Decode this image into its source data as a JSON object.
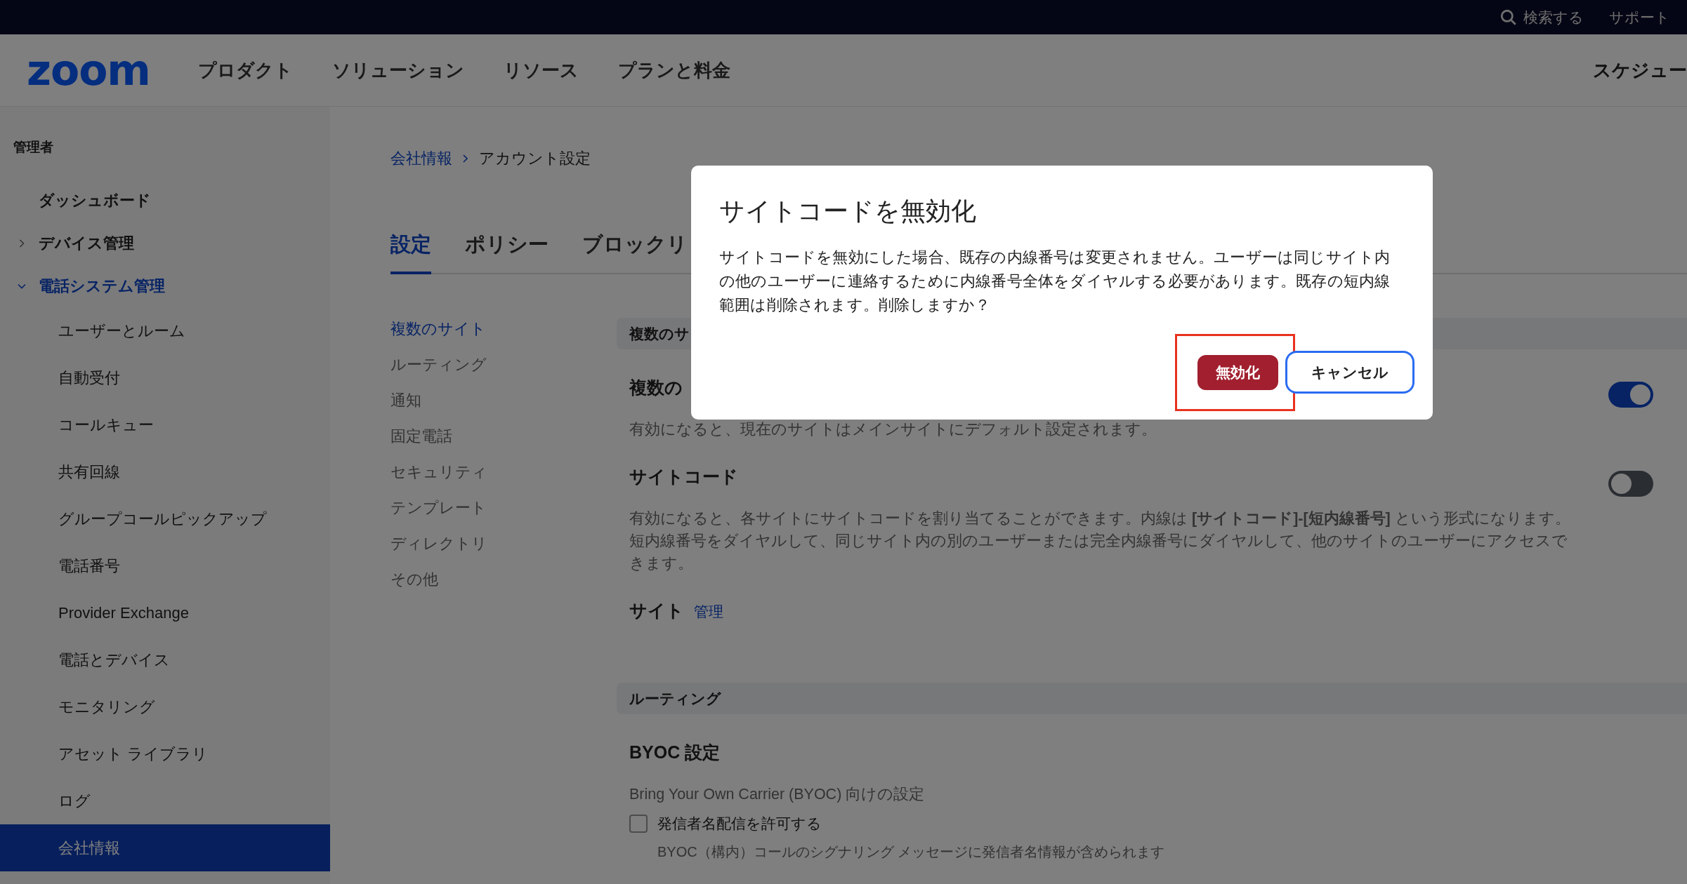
{
  "top_bar": {
    "search_label": "検索する",
    "support": "サポート"
  },
  "nav": {
    "logo": "zoom",
    "items": [
      "プロダクト",
      "ソリューション",
      "リソース",
      "プランと料金"
    ],
    "right": "スケジュー"
  },
  "sidebar": {
    "heading": "管理者",
    "items": [
      {
        "label": "ダッシュボード"
      },
      {
        "label": "デバイス管理",
        "expanded": false
      },
      {
        "label": "電話システム管理",
        "expanded": true,
        "children": [
          {
            "label": "ユーザーとルーム",
            "selected": false
          },
          {
            "label": "自動受付",
            "selected": false
          },
          {
            "label": "コールキュー",
            "selected": false
          },
          {
            "label": "共有回線",
            "selected": false
          },
          {
            "label": "グループコールピックアップ",
            "selected": false
          },
          {
            "label": "電話番号",
            "selected": false
          },
          {
            "label": "Provider Exchange",
            "selected": false
          },
          {
            "label": "電話とデバイス",
            "selected": false
          },
          {
            "label": "モニタリング",
            "selected": false
          },
          {
            "label": "アセット ライブラリ",
            "selected": false
          },
          {
            "label": "ログ",
            "selected": false
          },
          {
            "label": "会社情報",
            "selected": true
          }
        ]
      }
    ]
  },
  "breadcrumb": [
    {
      "label": "会社情報",
      "kind": "link"
    },
    {
      "label": "アカウント設定",
      "kind": "current"
    }
  ],
  "tabs": [
    {
      "label": "設定",
      "selected": true
    },
    {
      "label": "ポリシー",
      "selected": false
    },
    {
      "label": "ブロックリ",
      "selected": false
    }
  ],
  "subnav": [
    {
      "label": "複数のサイト",
      "selected": true
    },
    {
      "label": "ルーティング",
      "selected": false
    },
    {
      "label": "通知",
      "selected": false
    },
    {
      "label": "固定電話",
      "selected": false
    },
    {
      "label": "セキュリティ",
      "selected": false
    },
    {
      "label": "テンプレート",
      "selected": false
    },
    {
      "label": "ディレクトリ",
      "selected": false
    },
    {
      "label": "その他",
      "selected": false
    }
  ],
  "sections": [
    {
      "header": "複数のサ",
      "settings": [
        {
          "kind": "toggle",
          "title": "複数の",
          "description": "有効になると、現在のサイトはメインサイトにデフォルト設定されます。",
          "on": true
        },
        {
          "kind": "toggle",
          "title": "サイトコード",
          "description": "有効になると、各サイトにサイトコードを割り当てることができます。内線は **[サイトコード]-[短内線番号]** という形式になります。短内線番号をダイヤルして、同じサイト内の別のユーザーまたは完全内線番号にダイヤルして、他のサイトのユーザーにアクセスできます。",
          "on": false
        },
        {
          "kind": "link",
          "title": "サイト",
          "link": "管理"
        }
      ]
    },
    {
      "header": "ルーティング",
      "settings": [
        {
          "kind": "group",
          "title": "BYOC 設定",
          "description": "Bring Your Own Carrier (BYOC) 向けの設定"
        },
        {
          "kind": "checkbox",
          "title": "発信者名配信を許可する",
          "description": "BYOC（構内）コールのシグナリング メッセージに発信者名情報が含められます",
          "checked": false
        }
      ]
    }
  ],
  "dialog": {
    "title": "サイトコードを無効化",
    "body": "サイトコードを無効にした場合、既存の内線番号は変更されません。ユーザーは同じサイト内の他のユーザーに連絡するために内線番号全体をダイヤルする必要があります。既存の短内線範囲は削除されます。削除しますか？",
    "buttons": [
      {
        "label": "無効化",
        "kind": "primary",
        "highlighted": true
      },
      {
        "label": "キャンセル",
        "kind": "secondary",
        "highlighted": false
      }
    ]
  }
}
